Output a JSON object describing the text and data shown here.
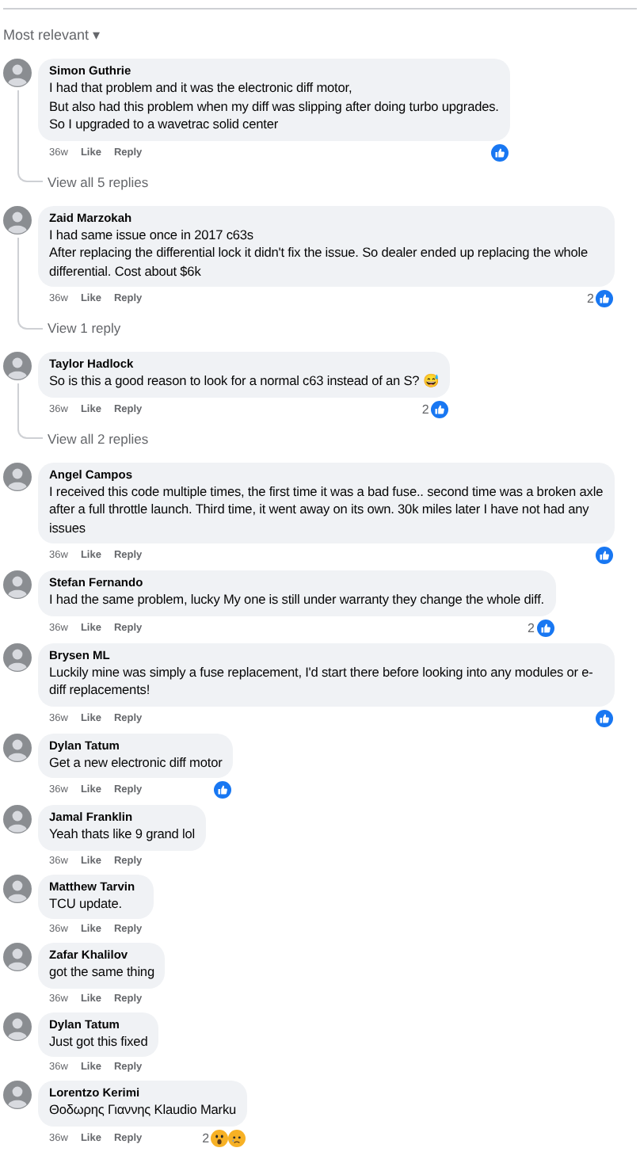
{
  "sort": {
    "label": "Most relevant",
    "caret": "▾"
  },
  "comments": [
    {
      "author": "Simon Guthrie",
      "text": "I had that problem and it was the electronic diff motor,\nBut also had this problem when my diff was slipping after doing turbo upgrades.\nSo I upgraded to a wavetrac solid center",
      "time": "36w",
      "like": "Like",
      "reply": "Reply",
      "reactions": [
        {
          "kind": "like"
        }
      ],
      "view_replies": "View all 5 replies"
    },
    {
      "author": "Zaid Marzokah",
      "text": "I had same issue once in 2017 c63s\nAfter replacing the differential lock it didn't fix the issue. So dealer ended up replacing the whole differential. Cost about $6k",
      "time": "36w",
      "like": "Like",
      "reply": "Reply",
      "reaction_count": "2",
      "reactions": [
        {
          "kind": "like"
        }
      ],
      "view_replies": "View 1 reply"
    },
    {
      "author": "Taylor Hadlock",
      "text": "So is this a good reason to look for a normal c63 instead of an S? 😅",
      "time": "36w",
      "like": "Like",
      "reply": "Reply",
      "reaction_count": "2",
      "reactions": [
        {
          "kind": "like"
        }
      ],
      "view_replies": "View all 2 replies"
    },
    {
      "author": "Angel Campos",
      "text": "I received this code multiple times, the first time it was a bad fuse.. second time was a broken axle after a full throttle launch. Third time, it went away on its own. 30k miles later I have not had any issues",
      "time": "36w",
      "like": "Like",
      "reply": "Reply",
      "reactions": [
        {
          "kind": "like"
        }
      ]
    },
    {
      "author": "Stefan Fernando",
      "text": "I had the same problem, lucky My one is still under warranty they change the whole diff.",
      "time": "36w",
      "like": "Like",
      "reply": "Reply",
      "reaction_count": "2",
      "reactions": [
        {
          "kind": "like"
        }
      ]
    },
    {
      "author": "Brysen ML",
      "text": "Luckily mine was simply a fuse replacement, I'd start there before looking into any modules or e-diff replacements!",
      "time": "36w",
      "like": "Like",
      "reply": "Reply",
      "reactions": [
        {
          "kind": "like"
        }
      ]
    },
    {
      "author": "Dylan Tatum",
      "text": "Get a new electronic diff motor",
      "time": "36w",
      "like": "Like",
      "reply": "Reply",
      "reactions": [
        {
          "kind": "like"
        }
      ]
    },
    {
      "author": "Jamal Franklin",
      "text": "Yeah thats like 9 grand lol",
      "time": "36w",
      "like": "Like",
      "reply": "Reply"
    },
    {
      "author": "Matthew Tarvin",
      "text": "TCU update.",
      "time": "36w",
      "like": "Like",
      "reply": "Reply"
    },
    {
      "author": "Zafar Khalilov",
      "text": "got the same thing",
      "time": "36w",
      "like": "Like",
      "reply": "Reply"
    },
    {
      "author": "Dylan Tatum",
      "text": "Just got this fixed",
      "time": "36w",
      "like": "Like",
      "reply": "Reply"
    },
    {
      "author": "Lorentzo Kerimi",
      "text": "Θοδωρης Γιαννης Klaudio Marku",
      "time": "36w",
      "like": "Like",
      "reply": "Reply",
      "reaction_count": "2",
      "reactions": [
        {
          "kind": "wow"
        },
        {
          "kind": "sad"
        }
      ]
    }
  ]
}
